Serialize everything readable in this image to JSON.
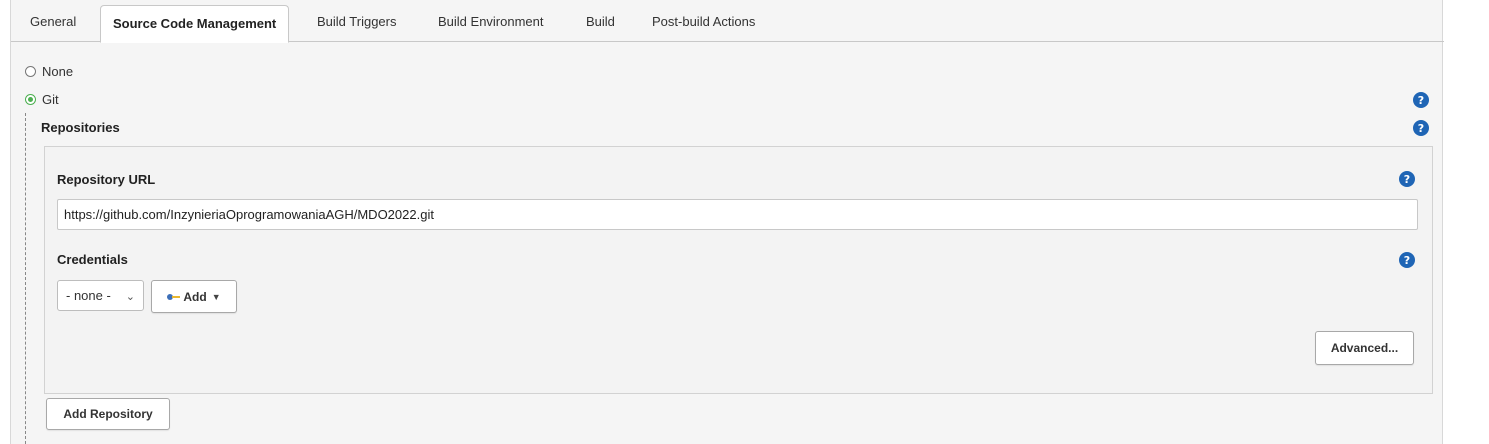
{
  "tabs": [
    "General",
    "Source Code Management",
    "Build Triggers",
    "Build Environment",
    "Build",
    "Post-build Actions"
  ],
  "active_tab": "Source Code Management",
  "scm": {
    "options": [
      {
        "label": "None",
        "checked": false
      },
      {
        "label": "Git",
        "checked": true
      }
    ],
    "repositories_label": "Repositories",
    "repository_url_label": "Repository URL",
    "repository_url_value": "https://github.com/InzynieriaOprogramowaniaAGH/MDO2022.git",
    "credentials_label": "Credentials",
    "credentials_selected": "- none -",
    "add_label": "Add",
    "advanced_label": "Advanced...",
    "add_repository_label": "Add Repository"
  },
  "help_glyph": "?",
  "colors": {
    "help_icon": "#1f65b5",
    "radio_checked": "#4caf50",
    "panel_bg": "#f5f5f5"
  }
}
